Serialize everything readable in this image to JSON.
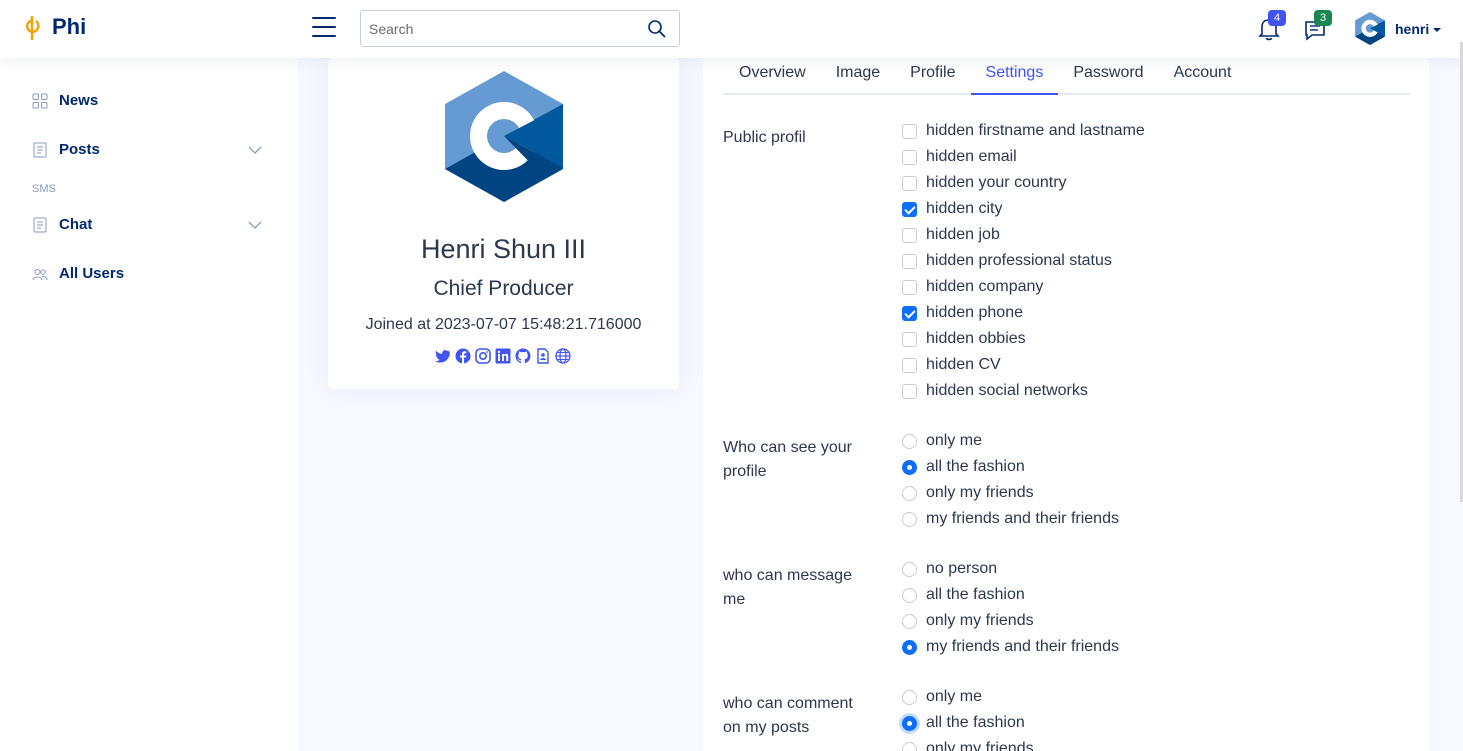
{
  "app": {
    "name": "Phi"
  },
  "header": {
    "search_placeholder": "Search",
    "notifications_count": "4",
    "messages_count": "3",
    "username": "henri",
    "colors": {
      "brand": "#012970",
      "accent": "#4154f1",
      "logo": "#f0a30a"
    }
  },
  "sidebar": {
    "items": [
      {
        "label": "News",
        "icon": "grid-icon"
      },
      {
        "label": "Posts",
        "icon": "document-icon"
      },
      {
        "label": "Chat",
        "icon": "document-icon"
      },
      {
        "label": "All Users",
        "icon": "people-icon"
      }
    ],
    "heading": "SMS"
  },
  "profile": {
    "name": "Henri Shun III",
    "job": "Chief Producer",
    "joined": "Joined at 2023-07-07 15:48:21.716000",
    "social": [
      "twitter-icon",
      "facebook-icon",
      "instagram-icon",
      "linkedin-icon",
      "github-icon",
      "cv-icon",
      "website-icon"
    ]
  },
  "tabs": [
    "Overview",
    "Image",
    "Profile",
    "Settings",
    "Password",
    "Account"
  ],
  "active_tab": "Settings",
  "settings": {
    "public_profile": {
      "label": "Public profil",
      "options": [
        {
          "label": "hidden firstname and lastname",
          "checked": false
        },
        {
          "label": "hidden email",
          "checked": false
        },
        {
          "label": "hidden your country",
          "checked": false
        },
        {
          "label": "hidden city",
          "checked": true
        },
        {
          "label": "hidden job",
          "checked": false
        },
        {
          "label": "hidden professional status",
          "checked": false
        },
        {
          "label": "hidden company",
          "checked": false
        },
        {
          "label": "hidden phone",
          "checked": true
        },
        {
          "label": "hidden obbies",
          "checked": false
        },
        {
          "label": "hidden CV",
          "checked": false
        },
        {
          "label": "hidden social networks",
          "checked": false
        }
      ]
    },
    "see_profile": {
      "label": "Who can see your profile",
      "options": [
        "only me",
        "all the fashion",
        "only my friends",
        "my friends and their friends"
      ],
      "selected": "all the fashion"
    },
    "message": {
      "label": "who can message me",
      "options": [
        "no person",
        "all the fashion",
        "only my friends",
        "my friends and their friends"
      ],
      "selected": "my friends and their friends"
    },
    "comment": {
      "label": "who can comment on my posts",
      "options": [
        "only me",
        "all the fashion",
        "only my friends"
      ],
      "selected": "all the fashion"
    }
  }
}
